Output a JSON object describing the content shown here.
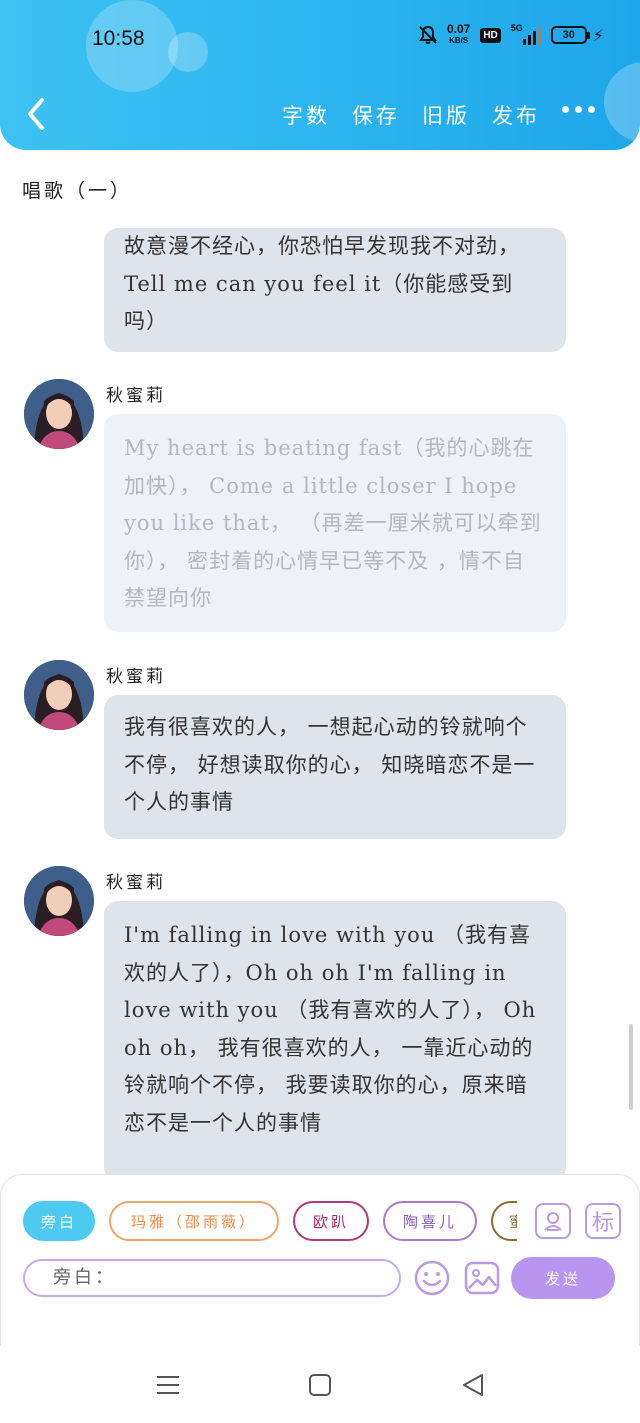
{
  "status_bar": {
    "time": "10:58",
    "net_speed_value": "0.07",
    "net_speed_unit": "KB/S",
    "hd_label": "HD",
    "network": "5G",
    "battery": "30"
  },
  "header": {
    "actions": [
      "字数",
      "保存",
      "旧版",
      "发布"
    ]
  },
  "document": {
    "title": "唱歌（一）"
  },
  "messages": [
    {
      "speaker": "",
      "text": "故意漫不经心，你恐怕早发现我不对劲，Tell me can you feel it（你能感受到吗）",
      "faded": false
    },
    {
      "speaker": "秋蜜莉",
      "text": "My heart is beating fast（我的心跳在加快）， Come a little closer I hope you like that， （再差一厘米就可以牵到你）， 密封着的心情早已等不及 ，情不自禁望向你",
      "faded": true
    },
    {
      "speaker": "秋蜜莉",
      "text": "我有很喜欢的人， 一想起心动的铃就响个不停， 好想读取你的心， 知晓暗恋不是一个人的事情",
      "faded": false
    },
    {
      "speaker": "秋蜜莉",
      "text": "I'm falling in love with you （我有喜欢的人了），Oh oh oh I'm falling in love with you （我有喜欢的人了）， Oh oh oh， 我有很喜欢的人， 一靠近心动的铃就响个不停， 我要读取你的心，原来暗恋不是一个人的事情",
      "faded": false
    }
  ],
  "composer": {
    "roles": [
      "旁白",
      "玛雅（邵雨薇）",
      "欧趴",
      "陶喜儿",
      "蜜"
    ],
    "role_icon": "person-card-icon",
    "tag_label": "标",
    "input_placeholder": "旁白：",
    "send_label": "发送"
  },
  "colors": {
    "header_blue": "#29b2ee",
    "bubble_gray": "#dfe3ea",
    "send_purple": "#b895ee",
    "active_chip": "#4ccaf0"
  }
}
